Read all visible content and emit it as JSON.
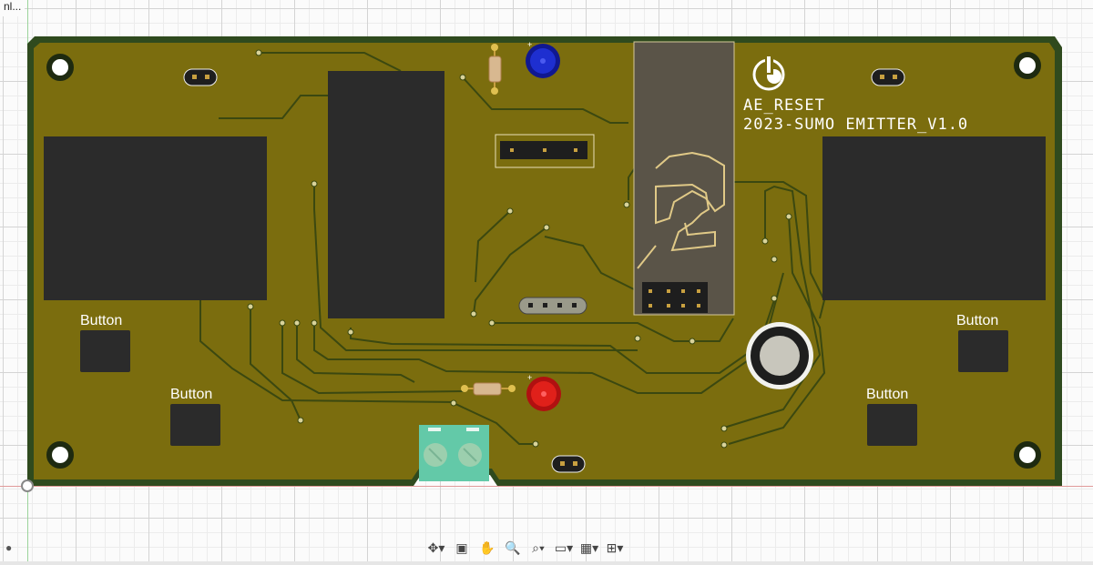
{
  "window": {
    "doc_tab_label": "nl..."
  },
  "colors": {
    "board_outline": "#2f4a1e",
    "board_fill": "#7b6d0e",
    "trace": "#3d4a10",
    "pad": "#2b2b2b",
    "silkscreen": "#ffffff",
    "led_blue": "#1e2fd0",
    "led_red": "#e0201a",
    "terminal_block": "#63c9a8",
    "module": "#5a5448"
  },
  "silkscreen": {
    "line1": "AE_RESET",
    "line2": "2023-SUMO EMITTER_V1.0"
  },
  "buttons": {
    "label_1": "Button",
    "label_2": "Button",
    "label_3": "Button",
    "label_4": "Button"
  },
  "toolbar": {
    "items": [
      {
        "name": "orbit-icon",
        "glyph": "✥▾"
      },
      {
        "name": "look-at-icon",
        "glyph": "▣"
      },
      {
        "name": "pan-icon",
        "glyph": "✋"
      },
      {
        "name": "zoom-icon",
        "glyph": "🔍"
      },
      {
        "name": "fit-icon",
        "glyph": "⌕▾"
      },
      {
        "name": "display-settings-icon",
        "glyph": "▭▾"
      },
      {
        "name": "grid-settings-icon",
        "glyph": "▦▾"
      },
      {
        "name": "viewports-icon",
        "glyph": "⊞▾"
      }
    ]
  },
  "statusbar": {
    "indicator": "●"
  }
}
